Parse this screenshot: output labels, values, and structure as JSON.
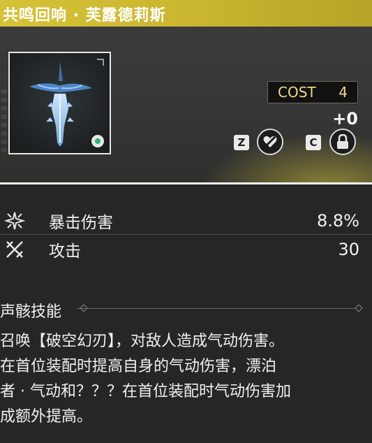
{
  "header": {
    "title": "共鸣回响 · 芙露德莉斯"
  },
  "card": {
    "cost_label": "COST",
    "cost_value": "4",
    "level": "+0",
    "keys": {
      "lock_favorite_key": "Z",
      "lock_key": "C"
    },
    "icons": {
      "echo_image": "sword-icon",
      "set_badge": "sonance-set-icon",
      "favorite": "heart-slash-icon",
      "lock": "lock-icon"
    }
  },
  "stats": [
    {
      "icon": "crit-damage-icon",
      "label": "暴击伤害",
      "value": "8.8%"
    },
    {
      "icon": "attack-icon",
      "label": "攻击",
      "value": "30"
    }
  ],
  "skill": {
    "title": "声骸技能",
    "lines": [
      "召唤【破空幻刃】，对敌人造成气动伤害。",
      "在首位装配时提高自身的气动伤害，漂泊",
      "者 · 气动和？？？在首位装配时气动伤害加",
      "成额外提高。"
    ]
  },
  "colors": {
    "header_accent": "#d6c238",
    "background": "#262626",
    "cost_text": "#f0d98a"
  }
}
